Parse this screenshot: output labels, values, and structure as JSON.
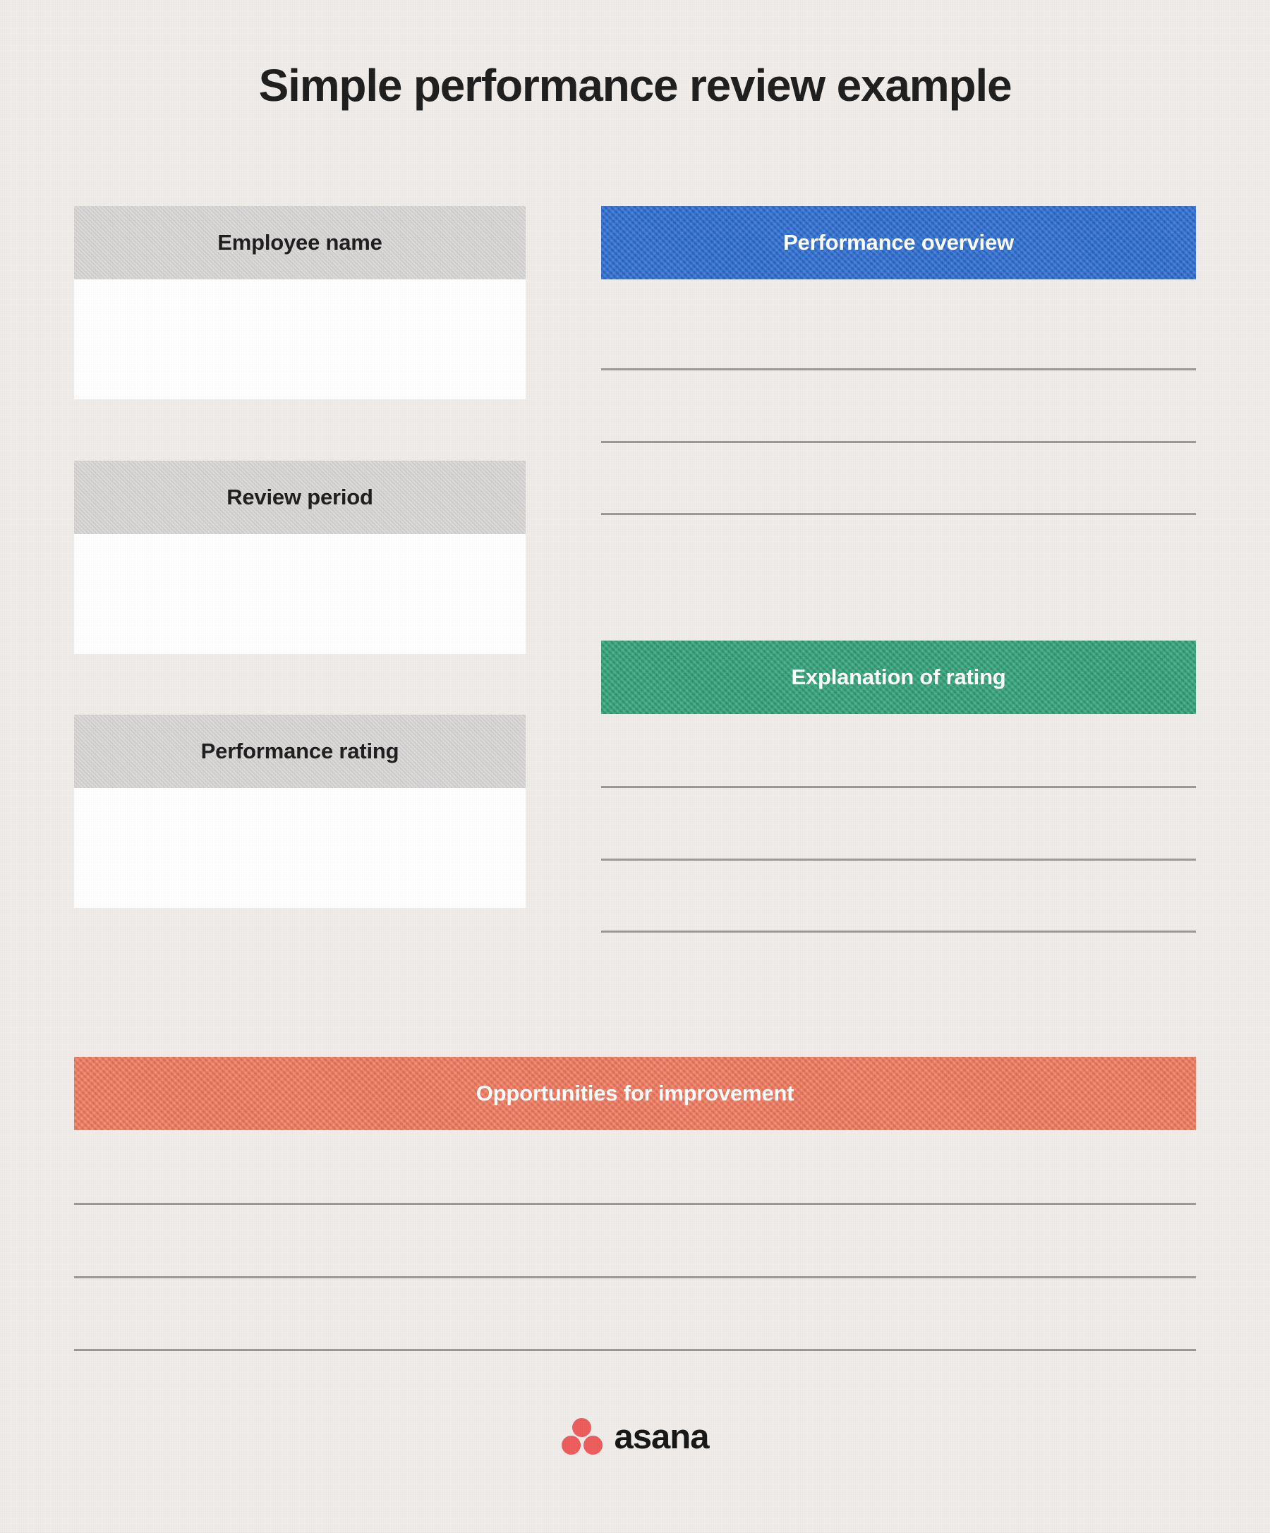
{
  "document": {
    "title": "Simple performance review example",
    "background_color": "#efecea"
  },
  "left_column": {
    "fields": [
      {
        "label": "Employee name",
        "value": "",
        "header_color": "#d2d0cf"
      },
      {
        "label": "Review period",
        "value": "",
        "header_color": "#d2d0cf"
      },
      {
        "label": "Performance rating",
        "value": "",
        "header_color": "#d2d0cf"
      }
    ]
  },
  "right_column": {
    "sections": [
      {
        "label": "Performance overview",
        "header_color": "#2a6dd4",
        "text_color": "#ffffff",
        "line_count": 3,
        "value": ""
      },
      {
        "label": "Explanation of rating",
        "header_color": "#2fa47a",
        "text_color": "#ffffff",
        "line_count": 3,
        "value": ""
      }
    ]
  },
  "full_width_section": {
    "label": "Opportunities for improvement",
    "header_color": "#f77a5e",
    "text_color": "#ffffff",
    "line_count": 3,
    "value": ""
  },
  "footer": {
    "logo_word": "asana",
    "logo_mark_color": "#ed5a5a",
    "logo_word_color": "#131212"
  }
}
